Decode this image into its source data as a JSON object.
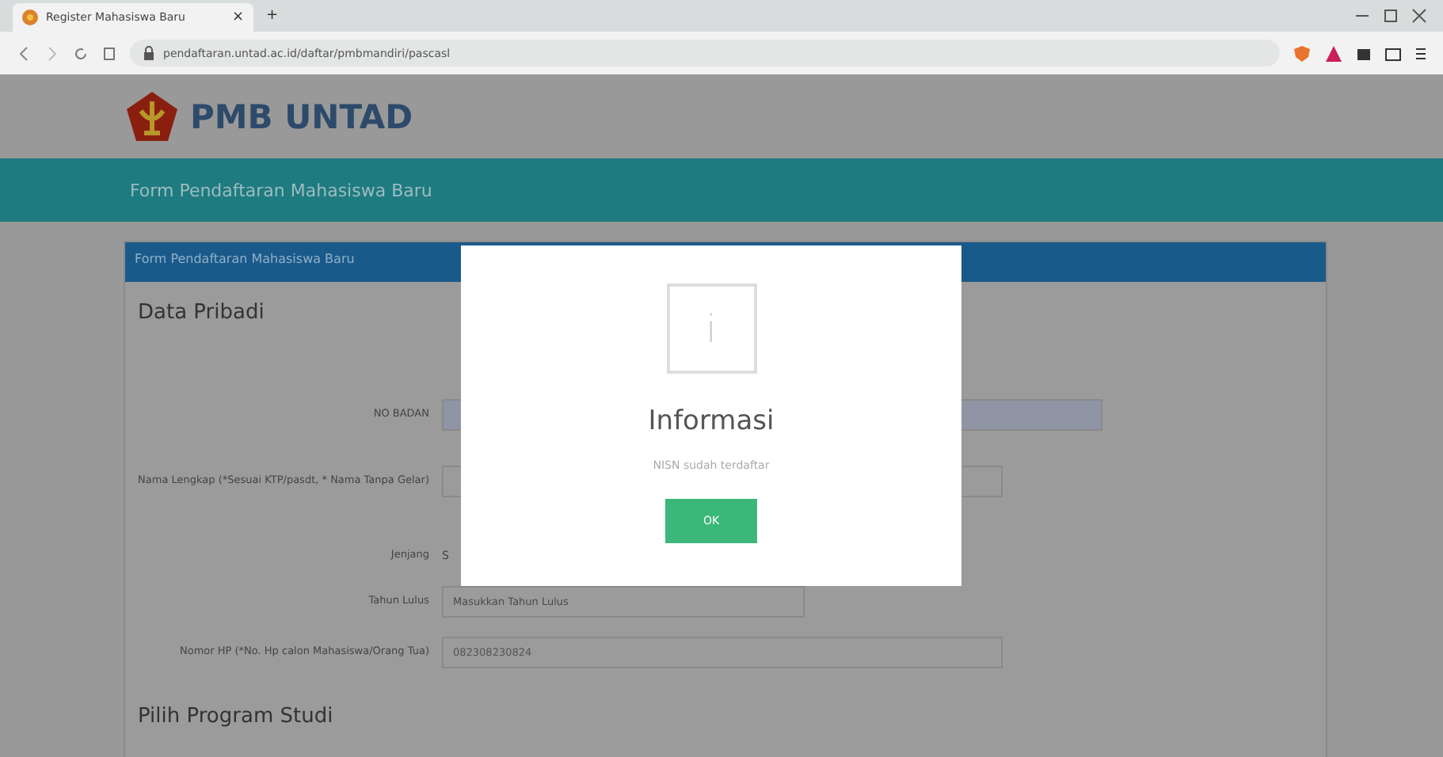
{
  "browser": {
    "tab_title": "Register Mahasiswa Baru",
    "tab_close": "×",
    "new_tab": "+",
    "url": "pendaftaran.untad.ac.id/daftar/pmbmandiri/pascasl"
  },
  "site": {
    "brand": "PMB UNTAD",
    "banner": "Form Pendaftaran Mahasiswa Baru"
  },
  "card": {
    "header": "Form Pendaftaran Mahasiswa Baru",
    "section": "Data Pribadi",
    "next_section": "Pilih Program Studi",
    "fields": [
      {
        "kind": "disabled",
        "label": "NO BADAN"
      },
      {
        "kind": "text",
        "label": "Nama Lengkap (*Sesuai KTP/pasdt, * Nama Tanpa Gelar)"
      },
      {
        "kind": "plain",
        "label": "Jenjang",
        "value": "S"
      },
      {
        "kind": "short",
        "label": "Tahun Lulus",
        "placeholder": "Masukkan Tahun Lulus"
      },
      {
        "kind": "text",
        "label": "Nomor HP (*No. Hp calon Mahasiswa/Orang Tua)",
        "value": "082308230824"
      }
    ]
  },
  "dialog": {
    "icon_text": "i",
    "title": "Informasi",
    "message": "NISN sudah terdaftar",
    "button": "OK"
  }
}
